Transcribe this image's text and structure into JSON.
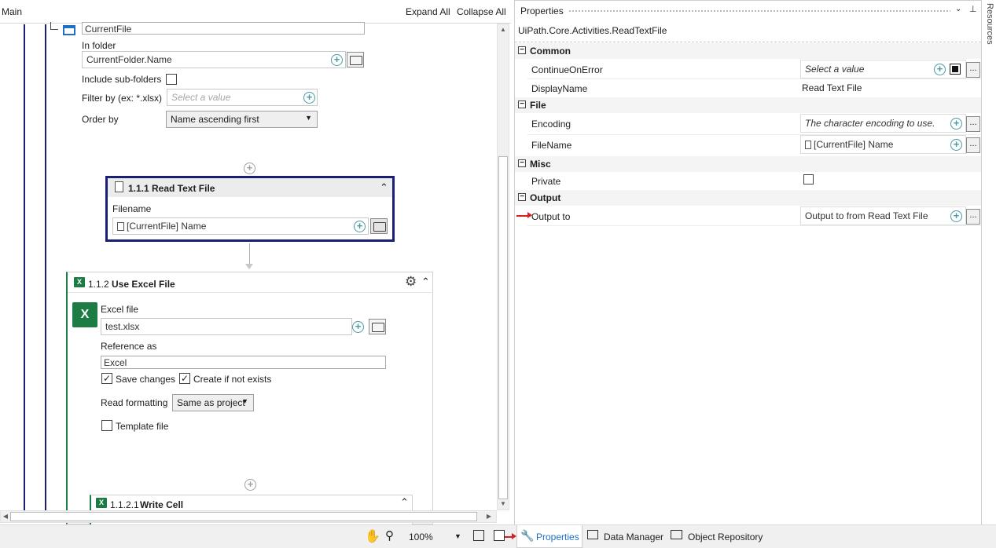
{
  "designer": {
    "breadcrumb": "Main",
    "expand_all": "Expand All",
    "collapse_all": "Collapse All",
    "for_each_file": {
      "item_name": "CurrentFile",
      "in_folder_label": "In folder",
      "in_folder_value": "CurrentFolder.Name",
      "include_subfolders_label": "Include sub-folders",
      "filter_label": "Filter by (ex: *.xlsx)",
      "filter_placeholder": "Select a value",
      "order_by_label": "Order by",
      "order_by_value": "Name ascending first"
    },
    "read_text_file": {
      "number": "1.1.1",
      "title": "Read Text File",
      "filename_label": "Filename",
      "filename_value": "[CurrentFile] Name"
    },
    "use_excel_file": {
      "number": "1.1.2",
      "title": "Use Excel File",
      "excel_file_label": "Excel file",
      "excel_file_value": "test.xlsx",
      "reference_label": "Reference as",
      "reference_value": "Excel",
      "save_changes_label": "Save changes",
      "save_changes_checked": true,
      "create_if_not_exists_label": "Create if not exists",
      "create_if_not_exists_checked": true,
      "read_formatting_label": "Read formatting",
      "read_formatting_value": "Same as project",
      "template_file_label": "Template file",
      "template_file_checked": false
    },
    "write_cell": {
      "number": "1.1.2.1",
      "title": "Write Cell"
    }
  },
  "statusbar": {
    "zoom": "100%"
  },
  "properties": {
    "title": "Properties",
    "type_name": "UiPath.Core.Activities.ReadTextFile",
    "sections": {
      "common": "Common",
      "file": "File",
      "misc": "Misc",
      "output": "Output"
    },
    "rows": {
      "continue_on_error": {
        "name": "ContinueOnError",
        "placeholder": "Select a value"
      },
      "display_name": {
        "name": "DisplayName",
        "value": "Read Text File"
      },
      "encoding": {
        "name": "Encoding",
        "placeholder": "The character encoding to use."
      },
      "file_name": {
        "name": "FileName",
        "value": "[CurrentFile] Name"
      },
      "private": {
        "name": "Private"
      },
      "output_to": {
        "name": "Output to",
        "value": "Output to from Read Text File"
      }
    },
    "dots": "..."
  },
  "bottom_tabs": {
    "properties": "Properties",
    "data_manager": "Data Manager",
    "object_repository": "Object Repository"
  },
  "side_tab": {
    "resources": "Resources"
  },
  "colors": {
    "selection_border": "#1b1f73",
    "excel_green": "#1d7b44",
    "annotation_red": "#d92020",
    "plus_teal": "#4a9aa3"
  }
}
